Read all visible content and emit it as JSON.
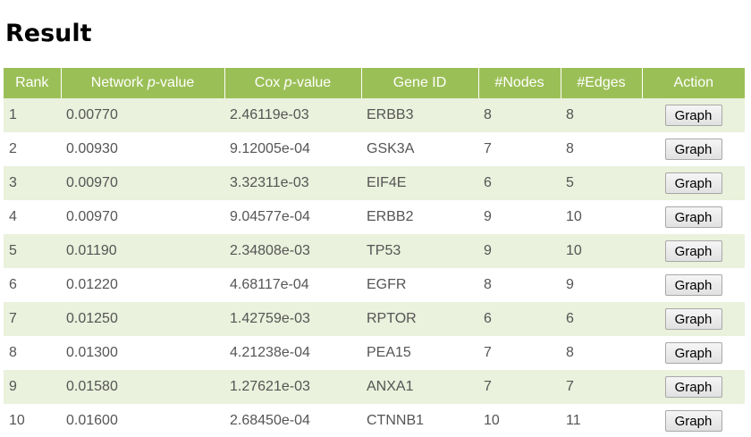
{
  "page": {
    "title": "Result"
  },
  "table": {
    "headers": {
      "rank": "Rank",
      "network_pvalue_prefix": "Network ",
      "network_pvalue_italic": "p",
      "network_pvalue_suffix": "-value",
      "cox_pvalue_prefix": "Cox ",
      "cox_pvalue_italic": "p",
      "cox_pvalue_suffix": "-value",
      "gene_id": "Gene ID",
      "nodes": "#Nodes",
      "edges": "#Edges",
      "action": "Action"
    },
    "rows": [
      {
        "rank": "1",
        "network_pvalue": "0.00770",
        "cox_pvalue": "2.46119e-03",
        "gene_id": "ERBB3",
        "nodes": "8",
        "edges": "8",
        "action": "Graph"
      },
      {
        "rank": "2",
        "network_pvalue": "0.00930",
        "cox_pvalue": "9.12005e-04",
        "gene_id": "GSK3A",
        "nodes": "7",
        "edges": "8",
        "action": "Graph"
      },
      {
        "rank": "3",
        "network_pvalue": "0.00970",
        "cox_pvalue": "3.32311e-03",
        "gene_id": "EIF4E",
        "nodes": "6",
        "edges": "5",
        "action": "Graph"
      },
      {
        "rank": "4",
        "network_pvalue": "0.00970",
        "cox_pvalue": "9.04577e-04",
        "gene_id": "ERBB2",
        "nodes": "9",
        "edges": "10",
        "action": "Graph"
      },
      {
        "rank": "5",
        "network_pvalue": "0.01190",
        "cox_pvalue": "2.34808e-03",
        "gene_id": "TP53",
        "nodes": "9",
        "edges": "10",
        "action": "Graph"
      },
      {
        "rank": "6",
        "network_pvalue": "0.01220",
        "cox_pvalue": "4.68117e-04",
        "gene_id": "EGFR",
        "nodes": "8",
        "edges": "9",
        "action": "Graph"
      },
      {
        "rank": "7",
        "network_pvalue": "0.01250",
        "cox_pvalue": "1.42759e-03",
        "gene_id": "RPTOR",
        "nodes": "6",
        "edges": "6",
        "action": "Graph"
      },
      {
        "rank": "8",
        "network_pvalue": "0.01300",
        "cox_pvalue": "4.21238e-04",
        "gene_id": "PEA15",
        "nodes": "7",
        "edges": "8",
        "action": "Graph"
      },
      {
        "rank": "9",
        "network_pvalue": "0.01580",
        "cox_pvalue": "1.27621e-03",
        "gene_id": "ANXA1",
        "nodes": "7",
        "edges": "7",
        "action": "Graph"
      },
      {
        "rank": "10",
        "network_pvalue": "0.01600",
        "cox_pvalue": "2.68450e-04",
        "gene_id": "CTNNB1",
        "nodes": "10",
        "edges": "11",
        "action": "Graph"
      }
    ]
  },
  "colors": {
    "header_background": "#9bbf57",
    "odd_row_background": "#eaf1dc",
    "even_row_background": "#ffffff"
  }
}
